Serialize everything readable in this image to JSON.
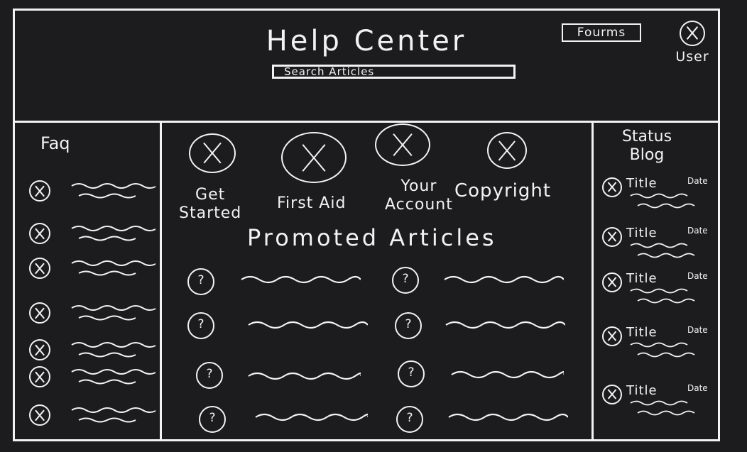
{
  "header": {
    "title": "Help Center",
    "search_placeholder": "Search Articles",
    "forums_label": "Fourms",
    "user_label": "User"
  },
  "faq": {
    "title": "Faq",
    "item_count_visible": 7
  },
  "categories": [
    {
      "label_line1": "Get",
      "label_line2": "Started"
    },
    {
      "label_line1": "First Aid",
      "label_line2": ""
    },
    {
      "label_line1": "Your",
      "label_line2": "Account"
    },
    {
      "label_line1": "Copyright",
      "label_line2": ""
    }
  ],
  "promoted": {
    "title": "Promoted Articles",
    "icon_text": "?"
  },
  "status_blog": {
    "title_line1": "Status",
    "title_line2": "Blog",
    "items": [
      {
        "title": "Title",
        "date": "Date"
      },
      {
        "title": "Title",
        "date": "Date"
      },
      {
        "title": "Title",
        "date": "Date"
      },
      {
        "title": "Title",
        "date": "Date"
      },
      {
        "title": "Title",
        "date": "Date"
      }
    ]
  },
  "colors": {
    "background": "#1c1c1e",
    "ink": "#f2f2f2"
  }
}
